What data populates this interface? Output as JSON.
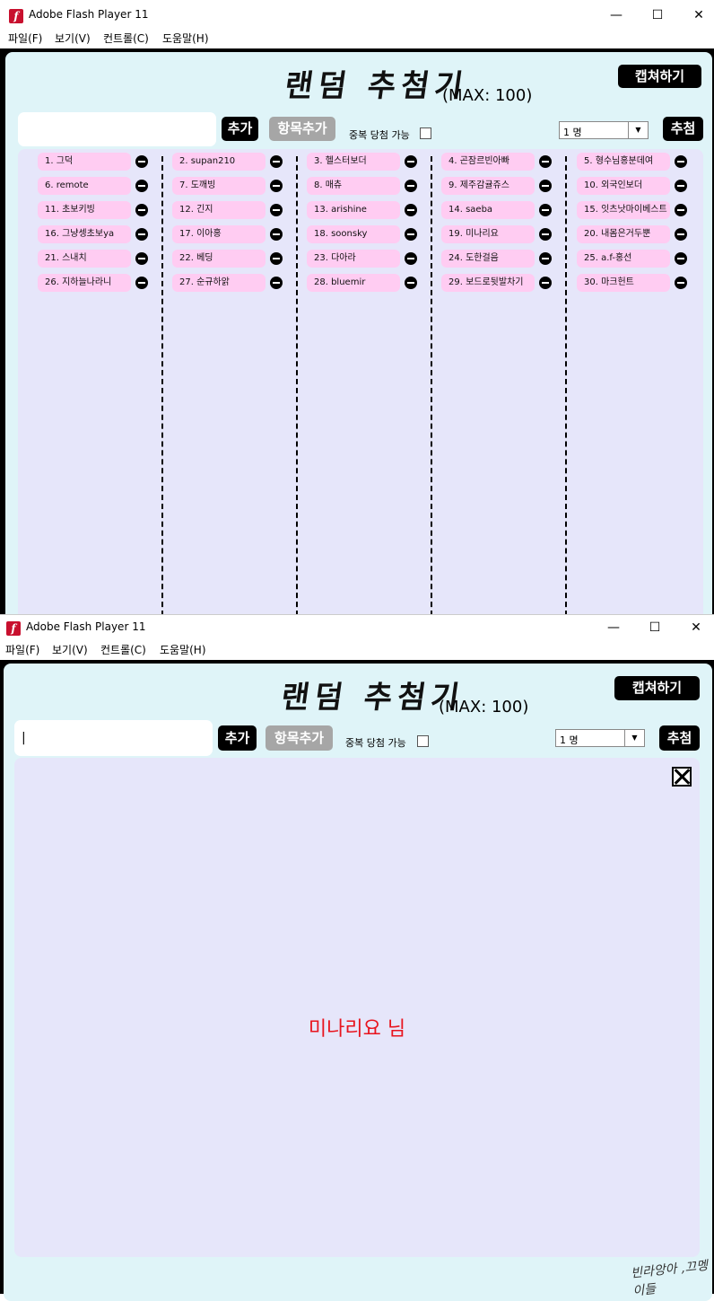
{
  "window": {
    "title": "Adobe Flash Player 11",
    "controls": {
      "minimize": "—",
      "maximize": "☐",
      "close": "✕"
    },
    "menu": [
      "파일(F)",
      "보기(V)",
      "컨트롤(C)",
      "도움말(H)"
    ]
  },
  "app": {
    "title": "랜덤 추첨기",
    "max_label": "(MAX: 100)",
    "capture_button": "캡쳐하기",
    "add_button": "추가",
    "add_items_button": "항목추가",
    "duplicate_label": "중복 당첨 가능",
    "count_select": {
      "value": "1 명"
    },
    "draw_button": "추첨"
  },
  "list_window": {
    "input_value": "",
    "items": [
      "1. 그덕",
      "2. supan210",
      "3. 헬스터보더",
      "4. 곤잠르빈아빠",
      "5. 형수님홍분데여",
      "6. remote",
      "7. 도깨빙",
      "8. 매츄",
      "9. 제주감귤쥬스",
      "10. 외국인보더",
      "11. 초보키빙",
      "12. 긴지",
      "13. arishine",
      "14. saeba",
      "15. 잇츠낫마이베스트",
      "16. 그냥셍초보ya",
      "17. 이아홍",
      "18. soonsky",
      "19. 미나리요",
      "20. 내몸은거두뿐",
      "21. 스내치",
      "22. 베딩",
      "23. 다아라",
      "24. 도한걸음",
      "25. a.f-홍선",
      "26. 지하늘나라니",
      "27. 순규하앍",
      "28. bluemir",
      "29. 보드로뒷발차기",
      "30. 마크헌트"
    ]
  },
  "result_window": {
    "input_value": "|",
    "winner_text": "미나리요 님",
    "winner_color": "#e8141e",
    "signature": "빈라앙아 ,끄멩이들"
  },
  "colors": {
    "stage_bg": "#dff4f8",
    "panel_bg": "#e6e6fa",
    "item_bg": "#ffccf2",
    "button_black": "#000000",
    "button_gray": "#a6a6a6"
  }
}
